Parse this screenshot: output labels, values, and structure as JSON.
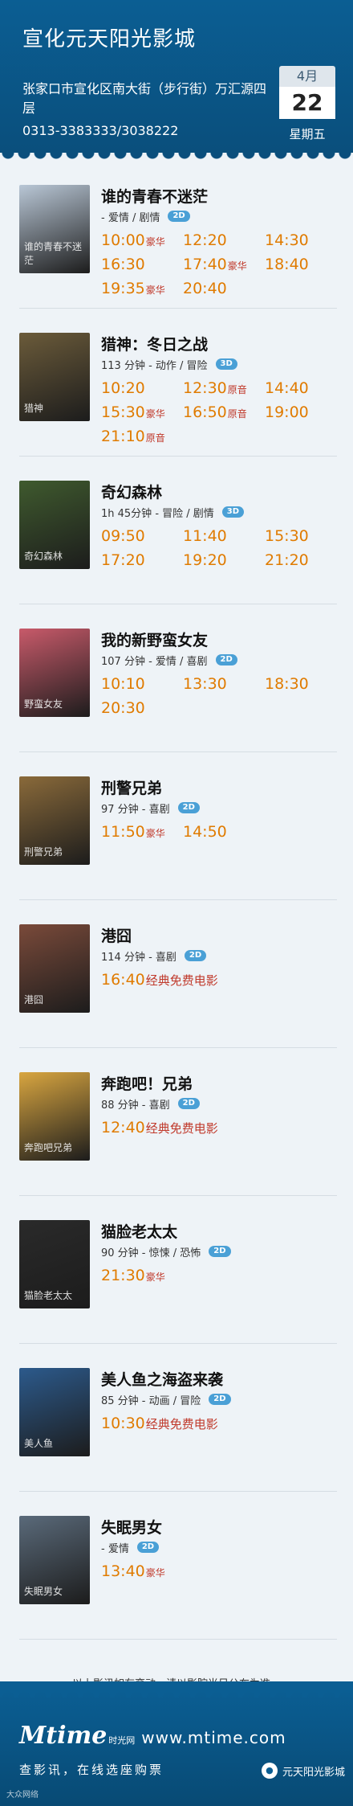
{
  "header": {
    "title": "宣化元天阳光影城",
    "address": "张家口市宣化区南大街（步行街）万汇源四层",
    "phone": "0313-3383333/3038222",
    "month": "4月",
    "day": "22",
    "weekday": "星期五"
  },
  "colors": {
    "header_bg": "#0b5e93",
    "showtime": "#e07b00",
    "tag": "#c0392b",
    "format_badge": "#4aa0d6"
  },
  "movies": [
    {
      "title": "谁的青春不迷茫",
      "meta": " - 爱情 / 剧情",
      "format": "2D",
      "poster_text": "谁的青春不迷茫",
      "times": [
        {
          "t": "10:00",
          "tag": "豪华"
        },
        {
          "t": "12:20",
          "tag": ""
        },
        {
          "t": "14:30",
          "tag": ""
        },
        {
          "t": "16:30",
          "tag": ""
        },
        {
          "t": "17:40",
          "tag": "豪华"
        },
        {
          "t": "18:40",
          "tag": ""
        },
        {
          "t": "19:35",
          "tag": "豪华"
        },
        {
          "t": "20:40",
          "tag": ""
        }
      ]
    },
    {
      "title": "猎神：冬日之战",
      "meta": "113 分钟 - 动作 / 冒险",
      "format": "3D",
      "poster_text": "猎神",
      "times": [
        {
          "t": "10:20",
          "tag": ""
        },
        {
          "t": "12:30",
          "tag": "原音"
        },
        {
          "t": "14:40",
          "tag": ""
        },
        {
          "t": "15:30",
          "tag": "豪华"
        },
        {
          "t": "16:50",
          "tag": "原音"
        },
        {
          "t": "19:00",
          "tag": ""
        },
        {
          "t": "21:10",
          "tag": "原音"
        }
      ]
    },
    {
      "title": "奇幻森林",
      "meta": "1h 45分钟 - 冒险 / 剧情",
      "format": "3D",
      "poster_text": "奇幻森林",
      "times": [
        {
          "t": "09:50",
          "tag": ""
        },
        {
          "t": "11:40",
          "tag": ""
        },
        {
          "t": "15:30",
          "tag": ""
        },
        {
          "t": "17:20",
          "tag": ""
        },
        {
          "t": "19:20",
          "tag": ""
        },
        {
          "t": "21:20",
          "tag": ""
        }
      ]
    },
    {
      "title": "我的新野蛮女友",
      "meta": "107 分钟 - 爱情 / 喜剧",
      "format": "2D",
      "poster_text": "野蛮女友",
      "times": [
        {
          "t": "10:10",
          "tag": ""
        },
        {
          "t": "13:30",
          "tag": ""
        },
        {
          "t": "18:30",
          "tag": ""
        },
        {
          "t": "20:30",
          "tag": ""
        }
      ]
    },
    {
      "title": "刑警兄弟",
      "meta": "97 分钟 - 喜剧",
      "format": "2D",
      "poster_text": "刑警兄弟",
      "times": [
        {
          "t": "11:50",
          "tag": "豪华"
        },
        {
          "t": "14:50",
          "tag": ""
        }
      ]
    },
    {
      "title": "港囧",
      "meta": "114 分钟 - 喜剧",
      "format": "2D",
      "poster_text": "港囧",
      "times": [
        {
          "t": "16:40",
          "tag": "经典免费电影",
          "free": true
        }
      ]
    },
    {
      "title": "奔跑吧！兄弟",
      "meta": "88 分钟 - 喜剧",
      "format": "2D",
      "poster_text": "奔跑吧兄弟",
      "times": [
        {
          "t": "12:40",
          "tag": "经典免费电影",
          "free": true
        }
      ]
    },
    {
      "title": "猫脸老太太",
      "meta": "90 分钟 - 惊悚 / 恐怖",
      "format": "2D",
      "poster_text": "猫脸老太太",
      "times": [
        {
          "t": "21:30",
          "tag": "豪华"
        }
      ]
    },
    {
      "title": "美人鱼之海盗来袭",
      "meta": "85 分钟 - 动画 / 冒险",
      "format": "2D",
      "poster_text": "美人鱼",
      "times": [
        {
          "t": "10:30",
          "tag": "经典免费电影",
          "free": true
        }
      ]
    },
    {
      "title": "失眠男女",
      "meta": " - 爱情",
      "format": "2D",
      "poster_text": "失眠男女",
      "times": [
        {
          "t": "13:40",
          "tag": "豪华"
        }
      ]
    }
  ],
  "notice": "以上影讯如有变动，请以影院当日公布为准。",
  "footer": {
    "logo": "Mtime",
    "logo_cn": "时光网",
    "site": "www.mtime.com",
    "slogan": "查影讯，在线选座购票",
    "watermark_left": "大众网络",
    "watermark_right": "元天阳光影城"
  }
}
